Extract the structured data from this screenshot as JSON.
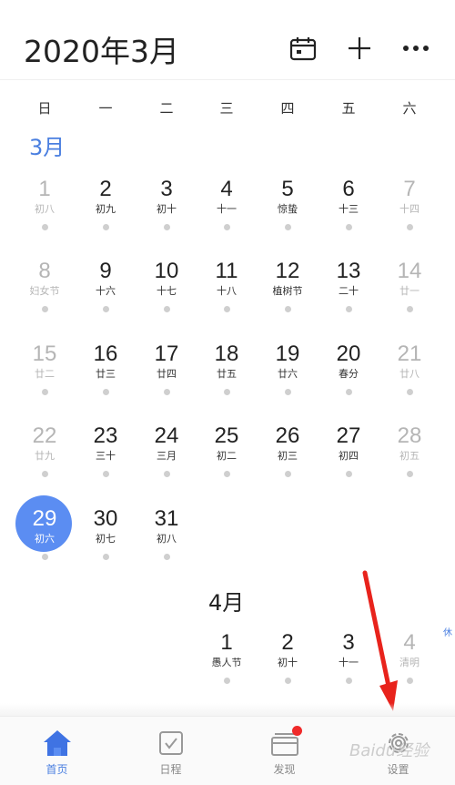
{
  "header": {
    "title": "2020年3月",
    "icons": [
      "calendar-icon",
      "plus-icon",
      "more-icon"
    ]
  },
  "weekdays": [
    "日",
    "一",
    "二",
    "三",
    "四",
    "五",
    "六"
  ],
  "months": {
    "march_label": "3月",
    "april_label": "4月"
  },
  "march_days": [
    {
      "num": "1",
      "sub": "初八"
    },
    {
      "num": "2",
      "sub": "初九"
    },
    {
      "num": "3",
      "sub": "初十"
    },
    {
      "num": "4",
      "sub": "十一"
    },
    {
      "num": "5",
      "sub": "惊蛰"
    },
    {
      "num": "6",
      "sub": "十三"
    },
    {
      "num": "7",
      "sub": "十四"
    },
    {
      "num": "8",
      "sub": "妇女节"
    },
    {
      "num": "9",
      "sub": "十六"
    },
    {
      "num": "10",
      "sub": "十七"
    },
    {
      "num": "11",
      "sub": "十八"
    },
    {
      "num": "12",
      "sub": "植树节"
    },
    {
      "num": "13",
      "sub": "二十"
    },
    {
      "num": "14",
      "sub": "廿一"
    },
    {
      "num": "15",
      "sub": "廿二"
    },
    {
      "num": "16",
      "sub": "廿三"
    },
    {
      "num": "17",
      "sub": "廿四"
    },
    {
      "num": "18",
      "sub": "廿五"
    },
    {
      "num": "19",
      "sub": "廿六"
    },
    {
      "num": "20",
      "sub": "春分"
    },
    {
      "num": "21",
      "sub": "廿八"
    },
    {
      "num": "22",
      "sub": "廿九"
    },
    {
      "num": "23",
      "sub": "三十"
    },
    {
      "num": "24",
      "sub": "三月"
    },
    {
      "num": "25",
      "sub": "初二"
    },
    {
      "num": "26",
      "sub": "初三"
    },
    {
      "num": "27",
      "sub": "初四"
    },
    {
      "num": "28",
      "sub": "初五"
    },
    {
      "num": "29",
      "sub": "初六"
    },
    {
      "num": "30",
      "sub": "初七"
    },
    {
      "num": "31",
      "sub": "初八"
    }
  ],
  "april_days": [
    {
      "num": "1",
      "sub": "愚人节"
    },
    {
      "num": "2",
      "sub": "初十"
    },
    {
      "num": "3",
      "sub": "十一"
    },
    {
      "num": "4",
      "sub": "清明",
      "tag": "休"
    }
  ],
  "tabs": [
    {
      "label": "首页",
      "icon": "home-icon"
    },
    {
      "label": "日程",
      "icon": "checkbox-icon"
    },
    {
      "label": "发现",
      "icon": "cards-icon"
    },
    {
      "label": "设置",
      "icon": "gear-icon"
    }
  ],
  "colors": {
    "accent": "#4a7fe0",
    "today": "#5b8df2",
    "badge": "#f02a2a",
    "arrow": "#e8231c"
  },
  "watermark": "Baidu经验"
}
